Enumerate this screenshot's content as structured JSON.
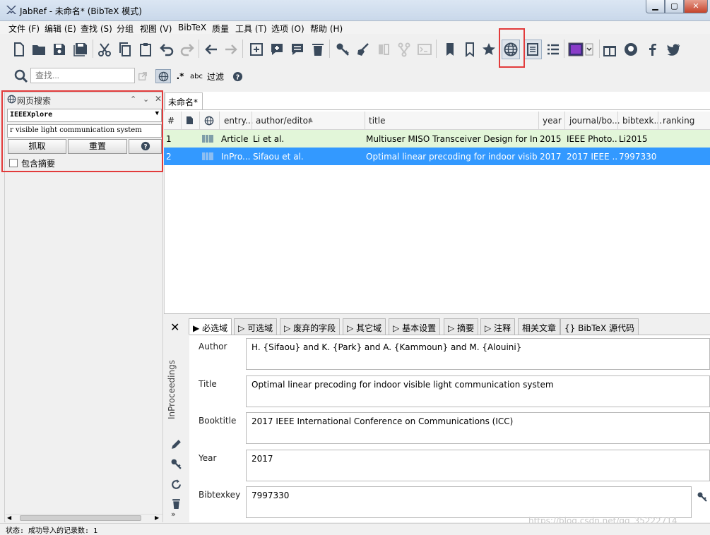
{
  "window": {
    "title": "JabRef - 未命名* (BibTeX 模式)"
  },
  "menu": [
    "文件 (F)",
    "编辑 (E)",
    "查找 (S)",
    "分组",
    "视图 (V)",
    "BibTeX",
    "质量",
    "工具 (T)",
    "选项 (O)",
    "帮助 (H)"
  ],
  "search": {
    "placeholder": "查找...",
    "filter_label": "过滤",
    "abc_label": "abc"
  },
  "web_search": {
    "title": "网页搜索",
    "fetcher": "IEEEXplore",
    "query": "r visible light communication system",
    "fetch_label": "抓取",
    "reset_label": "重置",
    "help_label": "?",
    "include_abstract_label": "包含摘要"
  },
  "database_tab": {
    "label": "未命名*"
  },
  "table": {
    "columns": [
      "#",
      "",
      "",
      "entry...",
      "author/editor",
      "title",
      "year",
      "journal/bo...",
      "bibtexk...",
      "ranking"
    ],
    "rows": [
      {
        "num": "1",
        "type": "Article",
        "author": "Li et al.",
        "title": "Multiuser MISO Transceiver Design for Ind...",
        "year": "2015",
        "journal": "IEEE Photo...",
        "key": "Li2015"
      },
      {
        "num": "2",
        "type": "InPro...",
        "author": "Sifaou et al.",
        "title": "Optimal linear precoding for indoor visible l...",
        "year": "2017",
        "journal": "2017 IEEE ...",
        "key": "7997330"
      }
    ]
  },
  "editor": {
    "entry_type": "InProceedings",
    "tabs": [
      "必选域",
      "可选域",
      "废弃的字段",
      "其它域",
      "基本设置",
      "摘要",
      "注释",
      "相关文章",
      "{} BibTeX 源代码"
    ],
    "fields": [
      {
        "label": "Author",
        "value": "H. {Sifaou} and K. {Park} and A. {Kammoun} and M. {Alouini}"
      },
      {
        "label": "Title",
        "value": "Optimal linear precoding for indoor visible light communication system"
      },
      {
        "label": "Booktitle",
        "value": "2017 IEEE International Conference on Communications (ICC)"
      },
      {
        "label": "Year",
        "value": "2017"
      },
      {
        "label": "Bibtexkey",
        "value": "7997330"
      }
    ]
  },
  "status": {
    "text": "状态: 成功导入的记录数: 1"
  },
  "watermark": "https://blog.csdn.net/qq_35222714",
  "colors": {
    "selected_row": "#3399ff",
    "highlight_row": "#e2f6d9",
    "annotation": "#e23b3b"
  }
}
